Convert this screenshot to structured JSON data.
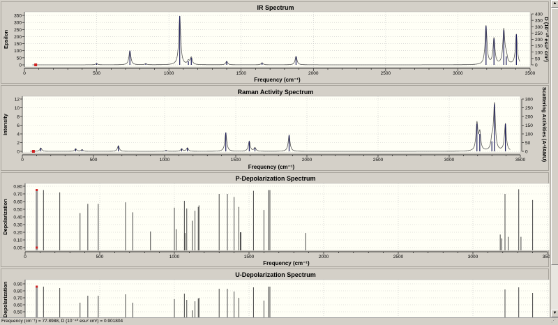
{
  "status_text": "Frequency (cm⁻¹) = 77.8988, D (10⁻⁴⁰ esu² cm²) = 0.901804",
  "icons": {
    "scroll_up": "▲",
    "scroll_down": "▼",
    "size_grip": "⋰"
  },
  "colors": {
    "plot_bg": "#fffff6",
    "line": "#555555",
    "peak": "#1a1a5a",
    "peak_fill": "#6e6ea8",
    "marker": "#d02020",
    "bar": "#444444",
    "grid": "#c8c8c8"
  },
  "chart_data": [
    {
      "id": "ir",
      "type": "line",
      "title": "IR Spectrum",
      "xlabel": "Frequency (cm⁻¹)",
      "ylabel": "Epsilon",
      "ylabel_right": "D (10⁻⁴⁰ esu² cm²)",
      "xlim": [
        0,
        3500
      ],
      "xticks": [
        0,
        500,
        1000,
        1500,
        2000,
        2500,
        3000,
        3500
      ],
      "ylim": [
        0,
        370
      ],
      "yticks": [
        0,
        50,
        100,
        150,
        200,
        250,
        300,
        350
      ],
      "ylim_right": [
        0,
        400
      ],
      "yticks_right": [
        0,
        50,
        100,
        150,
        200,
        250,
        300,
        350,
        400
      ],
      "grid": true,
      "width": 8,
      "marker_x": 77.8988,
      "peaks": [
        [
          500,
          10
        ],
        [
          730,
          100
        ],
        [
          840,
          8
        ],
        [
          1075,
          345
        ],
        [
          1135,
          25
        ],
        [
          1155,
          50
        ],
        [
          1400,
          25
        ],
        [
          1645,
          15
        ],
        [
          1880,
          60
        ],
        [
          3195,
          275
        ],
        [
          3250,
          185
        ],
        [
          3318,
          245
        ],
        [
          3335,
          60
        ],
        [
          3405,
          215
        ]
      ]
    },
    {
      "id": "raman",
      "type": "line",
      "title": "Raman Activity Spectrum",
      "xlabel": "Frequency (cm⁻¹)",
      "ylabel": "Intensity",
      "ylabel_right": "Scattering Activities (A⁴/AMU)",
      "xlim": [
        0,
        3500
      ],
      "xticks": [
        0,
        500,
        1000,
        1500,
        2000,
        2500,
        3000,
        3500
      ],
      "ylim": [
        0,
        12
      ],
      "yticks": [
        0,
        2,
        4,
        6,
        8,
        10,
        12
      ],
      "ylim_right": [
        0,
        300
      ],
      "yticks_right": [
        0,
        50,
        100,
        150,
        200,
        250,
        300
      ],
      "grid": true,
      "width": 8,
      "marker_x": 77.8988,
      "peaks": [
        [
          130,
          0.8
        ],
        [
          375,
          0.6
        ],
        [
          420,
          0.4
        ],
        [
          675,
          1.3
        ],
        [
          1010,
          0.2
        ],
        [
          1120,
          0.6
        ],
        [
          1160,
          0.8
        ],
        [
          1430,
          4.3
        ],
        [
          1595,
          2.3
        ],
        [
          1635,
          0.8
        ],
        [
          1875,
          3.7
        ],
        [
          3195,
          6.3
        ],
        [
          3215,
          4.0
        ],
        [
          3300,
          2.3
        ],
        [
          3318,
          10.8
        ],
        [
          3395,
          6.3
        ]
      ]
    },
    {
      "id": "p-depol",
      "type": "bar",
      "title": "P-Depolarization Spectrum",
      "xlabel": "Frequency (cm⁻¹)",
      "ylabel": "Depolarization",
      "xlim": [
        0,
        3500
      ],
      "xticks": [
        0,
        500,
        1000,
        1500,
        2000,
        2500,
        3000,
        3500
      ],
      "ylim": [
        0,
        0.8
      ],
      "yticks": [
        "0.00",
        "0.10",
        "0.20",
        "0.30",
        "0.40",
        "0.50",
        "0.60",
        "0.70",
        "0.80"
      ],
      "grid": true,
      "marker_x": 77.8988,
      "bars": [
        [
          77.9,
          0.75
        ],
        [
          123,
          0.75
        ],
        [
          232,
          0.72
        ],
        [
          368,
          0.45
        ],
        [
          420,
          0.57
        ],
        [
          490,
          0.57
        ],
        [
          673,
          0.59
        ],
        [
          722,
          0.46
        ],
        [
          840,
          0.21
        ],
        [
          1000,
          0.52
        ],
        [
          1012,
          0.24
        ],
        [
          1067,
          0.61
        ],
        [
          1071,
          0.19
        ],
        [
          1083,
          0.51
        ],
        [
          1120,
          0.35
        ],
        [
          1138,
          0.48
        ],
        [
          1160,
          0.53
        ],
        [
          1165,
          0.55
        ],
        [
          1300,
          0.7
        ],
        [
          1355,
          0.7
        ],
        [
          1400,
          0.66
        ],
        [
          1432,
          0.53
        ],
        [
          1442,
          0.2
        ],
        [
          1446,
          0.2
        ],
        [
          1530,
          0.74
        ],
        [
          1600,
          0.49
        ],
        [
          1630,
          0.75
        ],
        [
          1640,
          0.75
        ],
        [
          1880,
          0.19
        ],
        [
          3183,
          0.17
        ],
        [
          3193,
          0.12
        ],
        [
          3215,
          0.7
        ],
        [
          3237,
          0.14
        ],
        [
          3307,
          0.76
        ],
        [
          3322,
          0.14
        ],
        [
          3400,
          0.62
        ]
      ]
    },
    {
      "id": "u-depol",
      "type": "bar",
      "title": "U-Depolarization Spectrum",
      "ylabel": "Depolarization",
      "xlim": [
        0,
        3500
      ],
      "ylim": [
        0.5,
        0.9
      ],
      "yticks": [
        "0.50",
        "0.60",
        "0.70",
        "0.80",
        "0.90"
      ],
      "grid": true,
      "marker_x": 77.8988,
      "bars": [
        [
          77.9,
          0.86
        ],
        [
          123,
          0.86
        ],
        [
          232,
          0.84
        ],
        [
          368,
          0.63
        ],
        [
          420,
          0.73
        ],
        [
          490,
          0.73
        ],
        [
          673,
          0.75
        ],
        [
          722,
          0.63
        ],
        [
          1000,
          0.68
        ],
        [
          1067,
          0.76
        ],
        [
          1083,
          0.67
        ],
        [
          1120,
          0.52
        ],
        [
          1138,
          0.65
        ],
        [
          1160,
          0.69
        ],
        [
          1165,
          0.7
        ],
        [
          1300,
          0.83
        ],
        [
          1355,
          0.83
        ],
        [
          1400,
          0.79
        ],
        [
          1432,
          0.7
        ],
        [
          1530,
          0.85
        ],
        [
          1600,
          0.66
        ],
        [
          1630,
          0.86
        ],
        [
          1640,
          0.86
        ],
        [
          3215,
          0.82
        ],
        [
          3307,
          0.85
        ],
        [
          3400,
          0.77
        ]
      ]
    }
  ]
}
